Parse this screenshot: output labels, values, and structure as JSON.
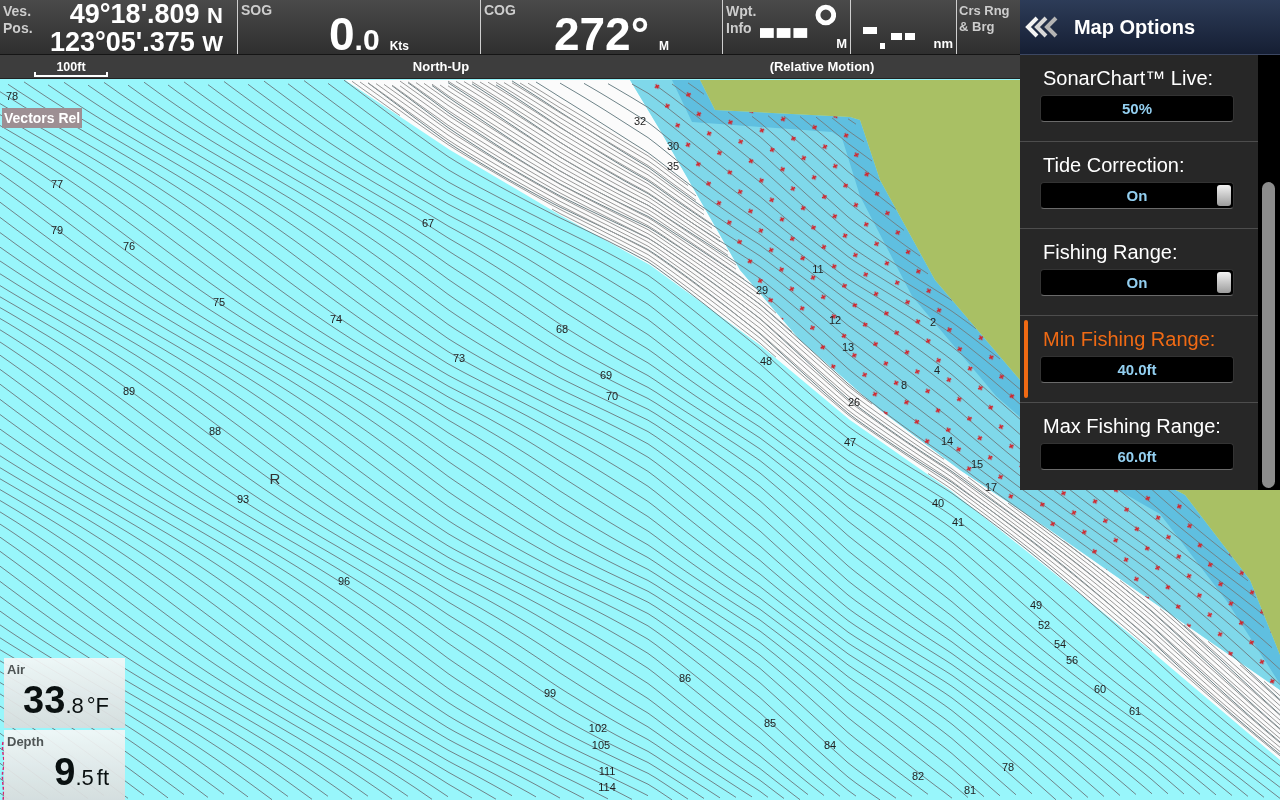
{
  "top_bar": {
    "cells": [
      {
        "kind": "position",
        "label_lines": [
          "Ves.",
          "Pos."
        ],
        "lines": [
          {
            "value": "49°18'.809",
            "suffix": "N"
          },
          {
            "value": "123°05'.375",
            "suffix": "W"
          }
        ]
      },
      {
        "kind": "reading",
        "label": "SOG",
        "integer": "0",
        "fraction": ".0",
        "unit": "Kts"
      },
      {
        "kind": "reading",
        "label": "COG",
        "integer": "272°",
        "unit": "M"
      },
      {
        "kind": "waypoint",
        "label_lines": [
          "Wpt.",
          "Info"
        ],
        "unit": "M"
      },
      {
        "kind": "blank",
        "unit": "nm"
      },
      {
        "kind": "label",
        "label_lines": [
          "Crs Rng",
          "& Brg"
        ]
      }
    ]
  },
  "status_bar": {
    "scale": "100ft",
    "orientation": "North-Up",
    "motion": "(Relative Motion)"
  },
  "menu": {
    "title": "Map Options",
    "items": [
      {
        "kind": "value",
        "label": "SonarChart™ Live:",
        "value": "50%",
        "selected": false
      },
      {
        "kind": "toggle",
        "label": "Tide Correction:",
        "value": "On",
        "on": true,
        "selected": false
      },
      {
        "kind": "toggle",
        "label": "Fishing Range:",
        "value": "On",
        "on": true,
        "selected": false
      },
      {
        "kind": "value",
        "label": "Min Fishing Range:",
        "value": "40.0ft",
        "selected": true
      },
      {
        "kind": "value",
        "label": "Max Fishing Range:",
        "value": "60.0ft",
        "selected": false
      }
    ]
  },
  "chart": {
    "overlay_label": "Vectors Rel",
    "bottom_type": "R",
    "soundings": [
      "78",
      "32",
      "30",
      "35",
      "77",
      "67",
      "79",
      "76",
      "11",
      "29",
      "75",
      "74",
      "12",
      "2",
      "68",
      "13",
      "73",
      "48",
      "4",
      "69",
      "8",
      "89",
      "70",
      "26",
      "88",
      "14",
      "47",
      "15",
      "17",
      "93",
      "40",
      "41",
      "96",
      "49",
      "52",
      "54",
      "56",
      "86",
      "60",
      "99",
      "61",
      "85",
      "102",
      "84",
      "105",
      "78",
      "111",
      "82",
      "114",
      "81"
    ]
  },
  "instruments": [
    {
      "label": "Air",
      "integer": "33",
      "fraction": ".8",
      "unit": "°F"
    },
    {
      "label": "Depth",
      "integer": "9",
      "fraction": ".5",
      "unit": "ft"
    }
  ]
}
